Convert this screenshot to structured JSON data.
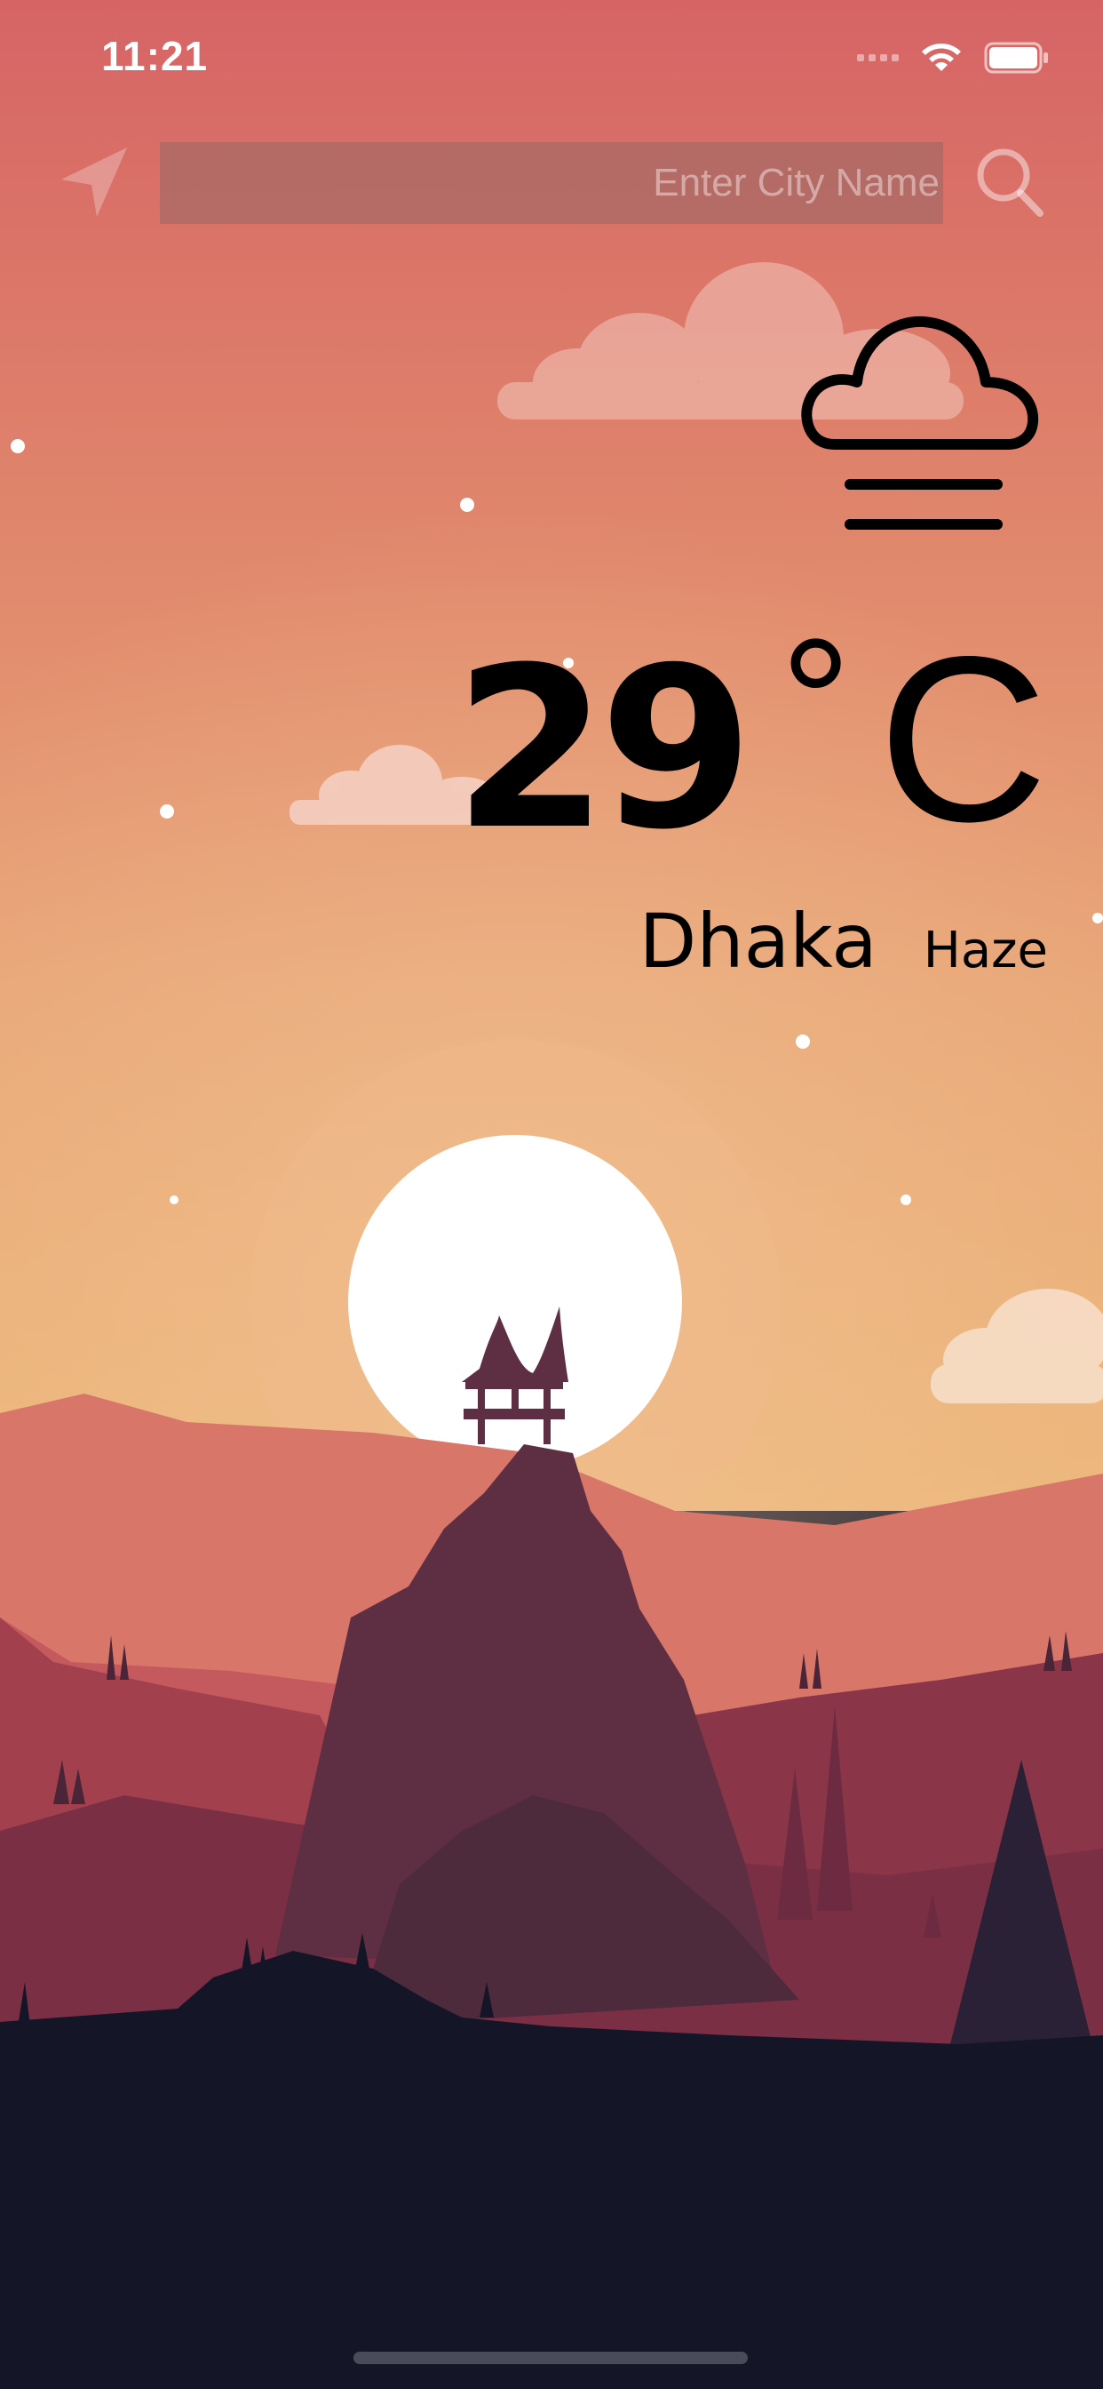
{
  "status_bar": {
    "time": "11:21"
  },
  "search": {
    "placeholder": "Enter City Name",
    "location_icon": "location-arrow-icon",
    "search_icon": "search-icon"
  },
  "weather": {
    "condition_icon": "haze-cloud-icon",
    "temperature": "29",
    "unit_symbol": "°",
    "unit_letter": "C",
    "city": "Dhaka",
    "condition": "Haze"
  },
  "theme": {
    "sky_top": "#d66465",
    "sky_mid": "#e08a6f",
    "sky_horizon": "#ebb57a",
    "sun": "#ffffff",
    "mountain_far": "#d8766a",
    "mountain_mid": "#9a3f4e",
    "peak": "#5e2f42",
    "ground": "#141628"
  }
}
